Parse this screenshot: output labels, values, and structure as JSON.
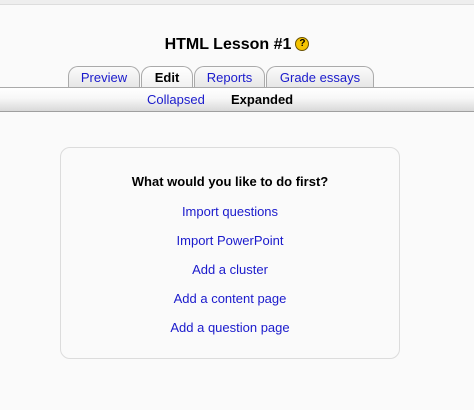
{
  "lesson": {
    "title": "HTML Lesson #1",
    "help_glyph": "?"
  },
  "tabs": [
    {
      "label": "Preview",
      "selected": false
    },
    {
      "label": "Edit",
      "selected": true
    },
    {
      "label": "Reports",
      "selected": false
    },
    {
      "label": "Grade essays",
      "selected": false
    }
  ],
  "subtabs": [
    {
      "label": "Collapsed",
      "selected": false
    },
    {
      "label": "Expanded",
      "selected": true
    }
  ],
  "panel": {
    "title": "What would you like to do first?",
    "actions": [
      "Import questions",
      "Import PowerPoint",
      "Add a cluster",
      "Add a content page",
      "Add a question page"
    ]
  },
  "colors": {
    "link": "#1a1acc",
    "background": "#fafafa",
    "help_icon": "#f5c400"
  },
  "icons": {
    "help": "help-icon"
  }
}
